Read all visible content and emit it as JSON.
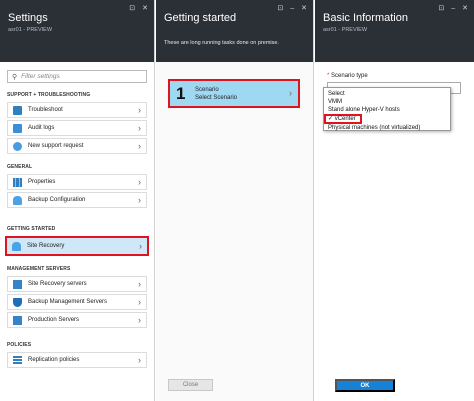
{
  "settings": {
    "title": "Settings",
    "subtitle": "asr01 - PREVIEW",
    "search_placeholder": "Filter settings",
    "sections": [
      {
        "header": "SUPPORT + TROUBLESHOOTING",
        "items": [
          "Troubleshoot",
          "Audit logs",
          "New support request"
        ]
      },
      {
        "header": "GENERAL",
        "items": [
          "Properties",
          "Backup Configuration"
        ]
      },
      {
        "header": "GETTING STARTED",
        "items": [
          "Site Recovery"
        ]
      },
      {
        "header": "MANAGEMENT SERVERS",
        "items": [
          "Site Recovery servers",
          "Backup Management Servers",
          "Production Servers"
        ]
      },
      {
        "header": "POLICIES",
        "items": [
          "Replication policies"
        ]
      }
    ]
  },
  "getting_started": {
    "title": "Getting started",
    "description": "These are long running tasks done on premise.",
    "step_number": "1",
    "step_title": "Scenario",
    "step_subtitle": "Select Scenario",
    "close_label": "Close"
  },
  "basic_info": {
    "title": "Basic Information",
    "subtitle": "asr01 - PREVIEW",
    "field_label": "Scenario type",
    "required_mark": "*",
    "options": [
      "Select",
      "VMM",
      "Stand alone Hyper-V hosts",
      "vCenter",
      "Physical machines (not virtualized)"
    ],
    "selected_option": "vCenter",
    "check_mark": "✓",
    "ok_label": "OK"
  },
  "window_buttons": {
    "pin": "⊡",
    "minimize": "–",
    "close": "✕"
  }
}
